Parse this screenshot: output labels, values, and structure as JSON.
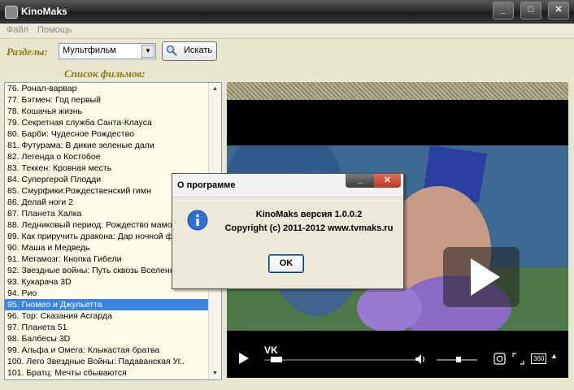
{
  "window": {
    "title": "KinoMaks",
    "minimize": "_",
    "maximize": "□",
    "close": "✕"
  },
  "menu": [
    "Файл",
    "Помощь"
  ],
  "toolbar": {
    "sections_label": "Разделы:",
    "section_selected": "Мультфильм",
    "search_label": "Искать"
  },
  "list": {
    "header": "Список фильмов:",
    "selected_index": 19,
    "items": [
      "76. Ронал-варвар",
      "77. Бэтмен: Год первый",
      "78. Кошачья жизнь",
      "79. Секретная служба Санта-Клауса",
      "80. Барби: Чудесное Рождество",
      "81. Футурама: В дикие зеленые дали",
      "82. Легенда о Костобое",
      "83. Теккен: Кровная месть",
      "84. Супергерой Плодди",
      "85. Смурфики:Рождественский гимн",
      "86. Делай ноги 2",
      "87. Планета Халка",
      "88. Ледниковый период: Рождество мамонта",
      "89. Как приручить дракона: Дар ночной фурии",
      "90. Маша и Медведь",
      "91. Мегамозг: Кнопка Гибели",
      "92. Звездные войны: Путь сквозь Вселенную",
      "93. Кукарача 3D",
      "94. Рио",
      "95. Гномео и Джульетта",
      "96. Тор: Сказания Асгарда",
      "97. Планета 51",
      "98. Балбесы 3D",
      "99. Альфа и Омега: Клыкастая братва",
      "100. Лего Звездные Войны: Падаванская Уг..",
      "101. Братц: Мечты сбываются"
    ]
  },
  "player": {
    "brand": "VK",
    "progress": 0.04,
    "volume": 0.55,
    "badge_360": "360"
  },
  "dialog": {
    "title": "О программе",
    "version": "KinoMaks версия 1.0.0.2",
    "copyright": "Copyright (c) 2011-2012 www.tvmaks.ru",
    "ok_label": "OK"
  }
}
